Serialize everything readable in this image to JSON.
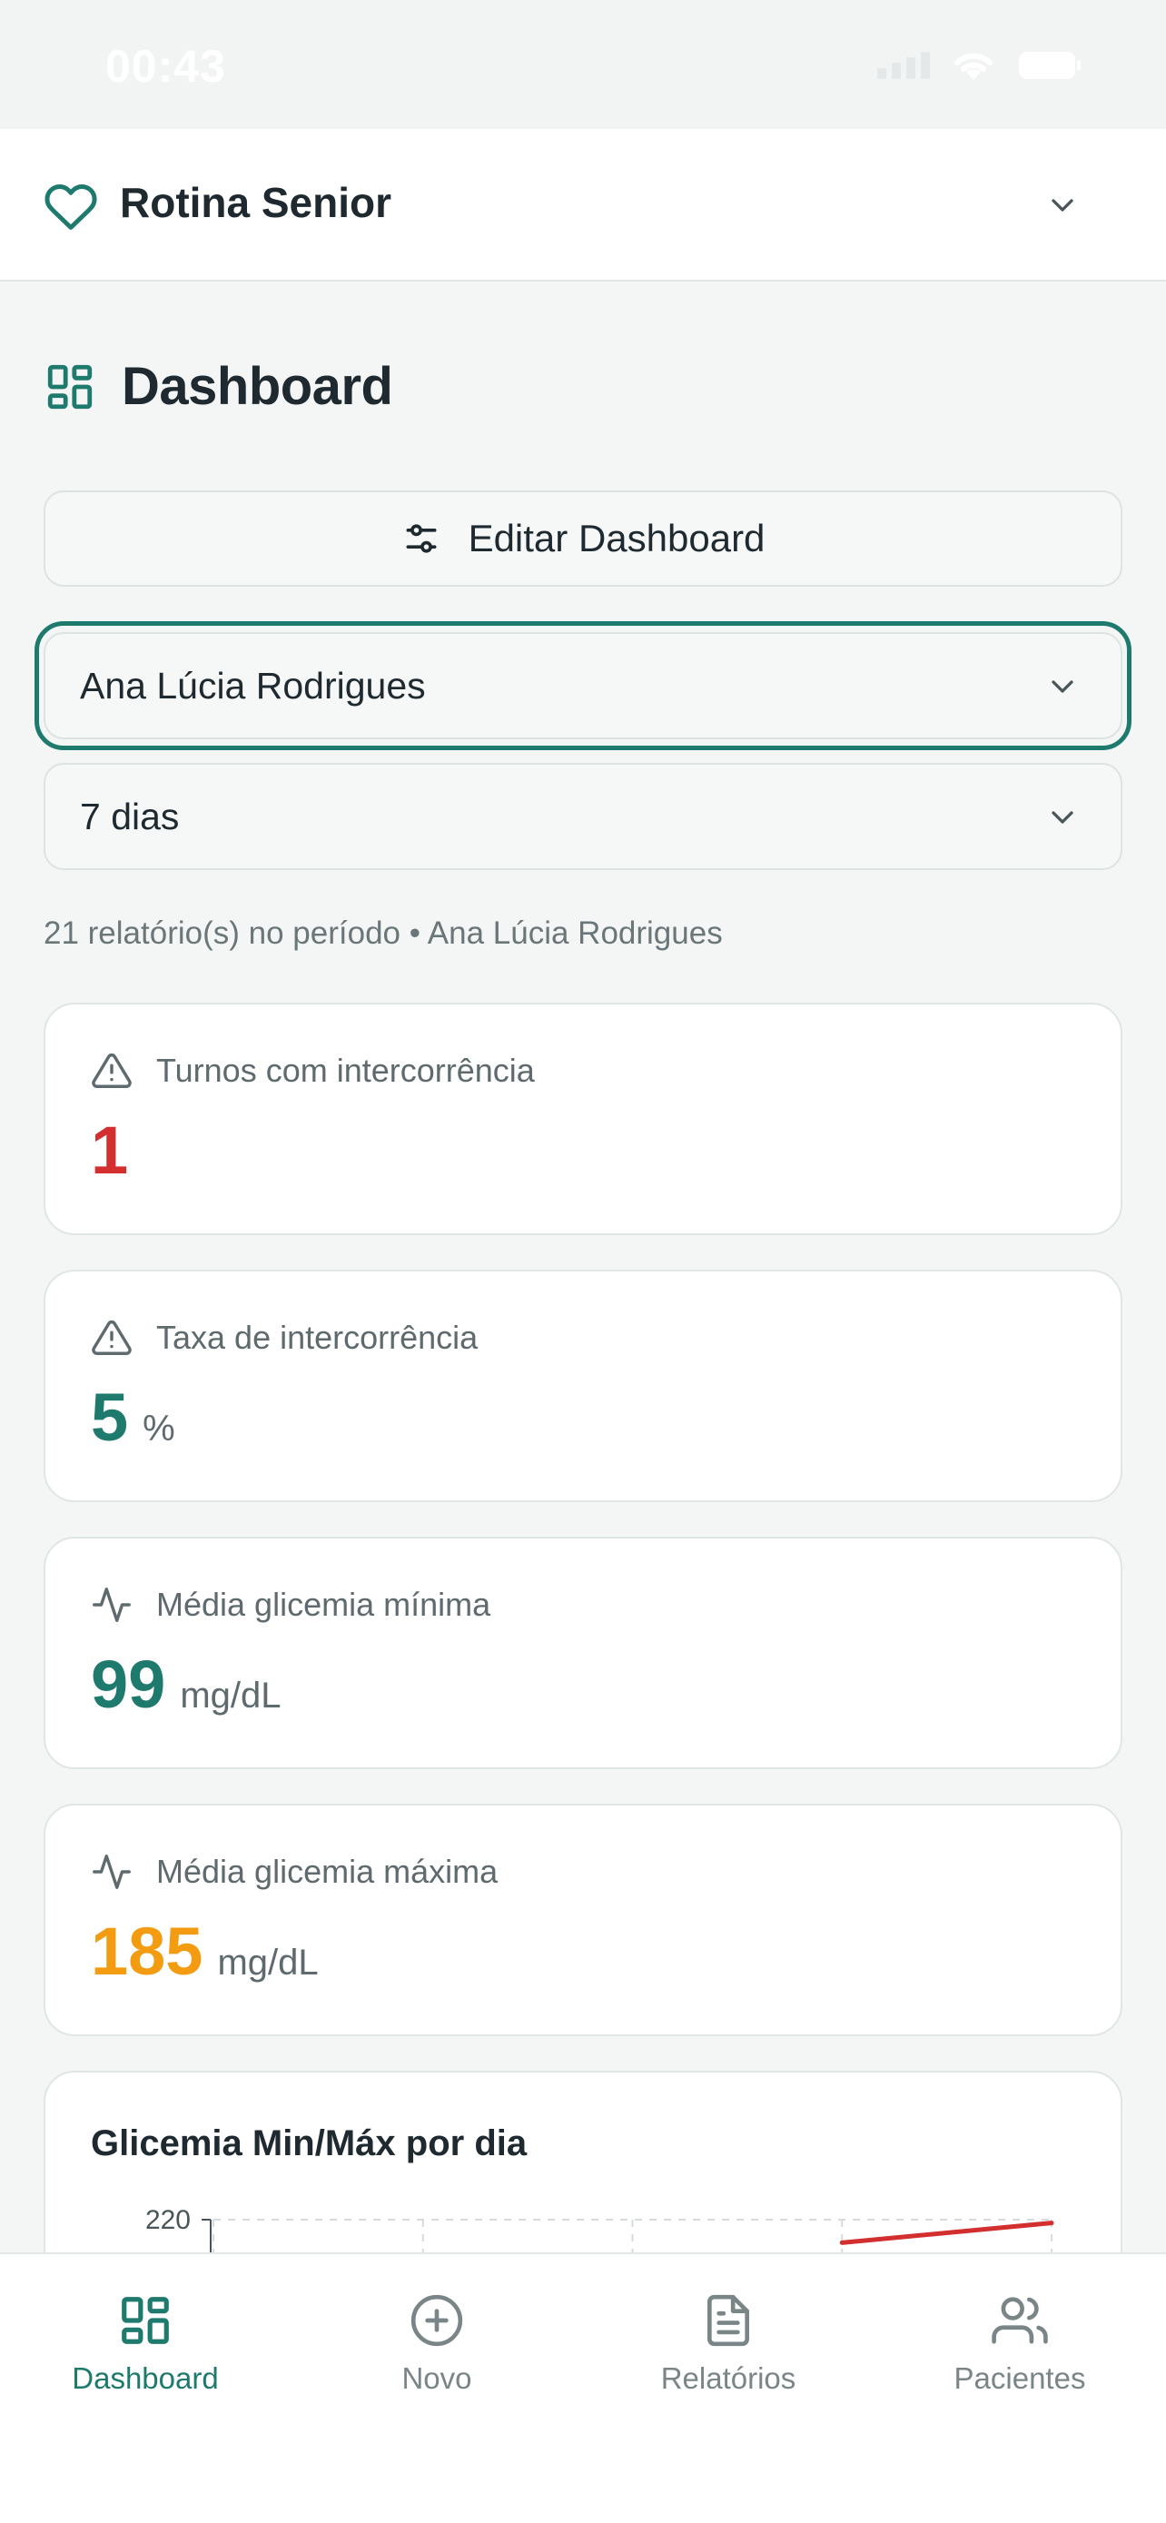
{
  "status_bar": {
    "time": "00:43"
  },
  "header": {
    "app_title": "Rotina Senior"
  },
  "dashboard": {
    "title": "Dashboard",
    "edit_button_label": "Editar Dashboard",
    "patient_select_value": "Ana Lúcia Rodrigues",
    "period_select_value": "7 dias",
    "summary_text": "21 relatório(s) no período • Ana Lúcia Rodrigues"
  },
  "cards": [
    {
      "label": "Turnos com intercorrência",
      "value": "1",
      "unit": "",
      "icon": "alert-triangle-icon",
      "color": "#d32f2f"
    },
    {
      "label": "Taxa de intercorrência",
      "value": "5",
      "unit": "%",
      "icon": "alert-triangle-icon",
      "color": "#1f7a6e"
    },
    {
      "label": "Média glicemia mínima",
      "value": "99",
      "unit": "mg/dL",
      "icon": "activity-icon",
      "color": "#1f7a6e"
    },
    {
      "label": "Média glicemia máxima",
      "value": "185",
      "unit": "mg/dL",
      "icon": "activity-icon",
      "color": "#f39c12"
    }
  ],
  "chart_data": {
    "type": "line",
    "title": "Glicemia Min/Máx por dia",
    "xlabel": "",
    "ylabel": "",
    "y_ticks_visible": [
      220
    ],
    "ylim": [
      0,
      220
    ],
    "grid": true,
    "series": [
      {
        "values": [
          null,
          null,
          null,
          206,
          218
        ],
        "color": "#d32f2f"
      }
    ]
  },
  "bottom_nav": {
    "items": [
      {
        "label": "Dashboard",
        "icon": "dashboard-icon",
        "active": true
      },
      {
        "label": "Novo",
        "icon": "plus-circle-icon",
        "active": false
      },
      {
        "label": "Relatórios",
        "icon": "file-text-icon",
        "active": false
      },
      {
        "label": "Pacientes",
        "icon": "users-icon",
        "active": false
      }
    ]
  },
  "colors": {
    "accent": "#1f7a6e",
    "danger": "#d32f2f",
    "warning": "#f39c12",
    "muted_text": "#6b7679"
  }
}
